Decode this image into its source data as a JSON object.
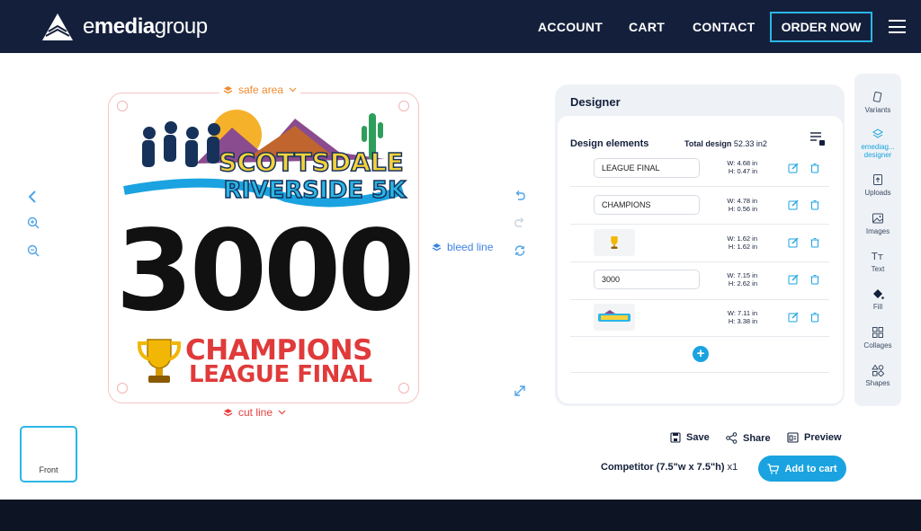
{
  "header": {
    "logo_light": "e",
    "logo_bold": "media",
    "logo_rest": "group",
    "nav": [
      "ACCOUNT",
      "CART",
      "CONTACT"
    ],
    "order_now": "ORDER NOW"
  },
  "canvas": {
    "safe_area": "safe area",
    "cut_line": "cut line",
    "bleed_line": "bleed line",
    "artwork": {
      "number": "3000",
      "champions": "CHAMPIONS",
      "league_final": "LEAGUE FINAL",
      "logo_line1": "SCOTTSDALE",
      "logo_line2": "RIVERSIDE 5K"
    }
  },
  "designer": {
    "title": "Designer",
    "elements_title": "Design elements",
    "total_design_label": "Total design",
    "total_design_value": "52.33 in2",
    "rows": [
      {
        "type": "text",
        "value": "LEAGUE FINAL",
        "w": "W: 4.68 in",
        "h": "H: 0.47 in"
      },
      {
        "type": "text",
        "value": "CHAMPIONS",
        "w": "W: 4.78 in",
        "h": "H: 0.56 in"
      },
      {
        "type": "image",
        "value": "trophy",
        "w": "W: 1.62 in",
        "h": "H: 1.62 in"
      },
      {
        "type": "text",
        "value": "3000",
        "w": "W: 7.15 in",
        "h": "H: 2.62 in"
      },
      {
        "type": "image",
        "value": "logo",
        "w": "W: 7.11 in",
        "h": "H: 3.38 in"
      }
    ],
    "add_symbol": "+"
  },
  "rail": [
    {
      "label": "Variants",
      "icon": "variants-icon"
    },
    {
      "label": "emediag... designer",
      "icon": "layers-icon",
      "active": true
    },
    {
      "label": "Uploads",
      "icon": "upload-icon"
    },
    {
      "label": "Images",
      "icon": "image-icon"
    },
    {
      "label": "Text",
      "icon": "text-icon"
    },
    {
      "label": "Fill",
      "icon": "fill-icon"
    },
    {
      "label": "Collages",
      "icon": "collage-icon"
    },
    {
      "label": "Shapes",
      "icon": "shapes-icon"
    }
  ],
  "thumbnail": {
    "label": "Front"
  },
  "actions": {
    "save": "Save",
    "share": "Share",
    "preview": "Preview"
  },
  "product": {
    "name": "Competitor (7.5\"w x 7.5\"h)",
    "qty": "x1",
    "add_to_cart": "Add to cart"
  },
  "colors": {
    "navy": "#14203b",
    "accent": "#1aa3e0",
    "red": "#e03a3a",
    "orange": "#f28a2e"
  }
}
